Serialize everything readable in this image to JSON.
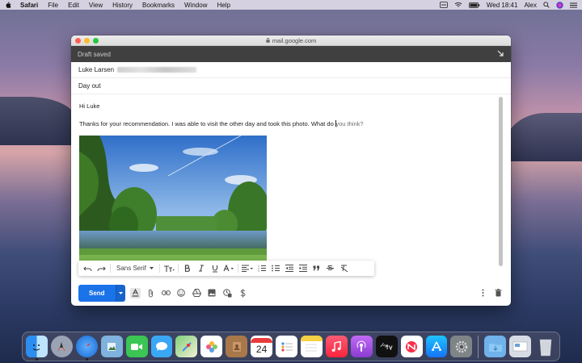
{
  "menubar": {
    "app_name": "Safari",
    "items": [
      "File",
      "Edit",
      "View",
      "History",
      "Bookmarks",
      "Window",
      "Help"
    ],
    "clock": "Wed 18:41",
    "user": "Alex"
  },
  "window": {
    "url": "mail.google.com",
    "compose_status": "Draft saved",
    "to_name": "Luke Larsen",
    "subject": "Day out",
    "greeting": "Hi Luke",
    "body_text": "Thanks for your recommendation. I was able to visit the other day and took this photo. What do",
    "body_hint": "you think?"
  },
  "format_bar": {
    "font_name": "Sans Serif"
  },
  "send": {
    "label": "Send"
  },
  "dock": {
    "calendar_day": "24",
    "apps": [
      "finder",
      "launchpad",
      "safari",
      "preview",
      "facetime",
      "messages",
      "maps",
      "photos",
      "contacts",
      "calendar",
      "reminders",
      "notes",
      "music",
      "podcasts",
      "tv",
      "news",
      "app-store",
      "system-preferences",
      "downloads",
      "trash"
    ]
  },
  "colors": {
    "send_blue": "#1a73e8",
    "compose_header": "#404040"
  }
}
